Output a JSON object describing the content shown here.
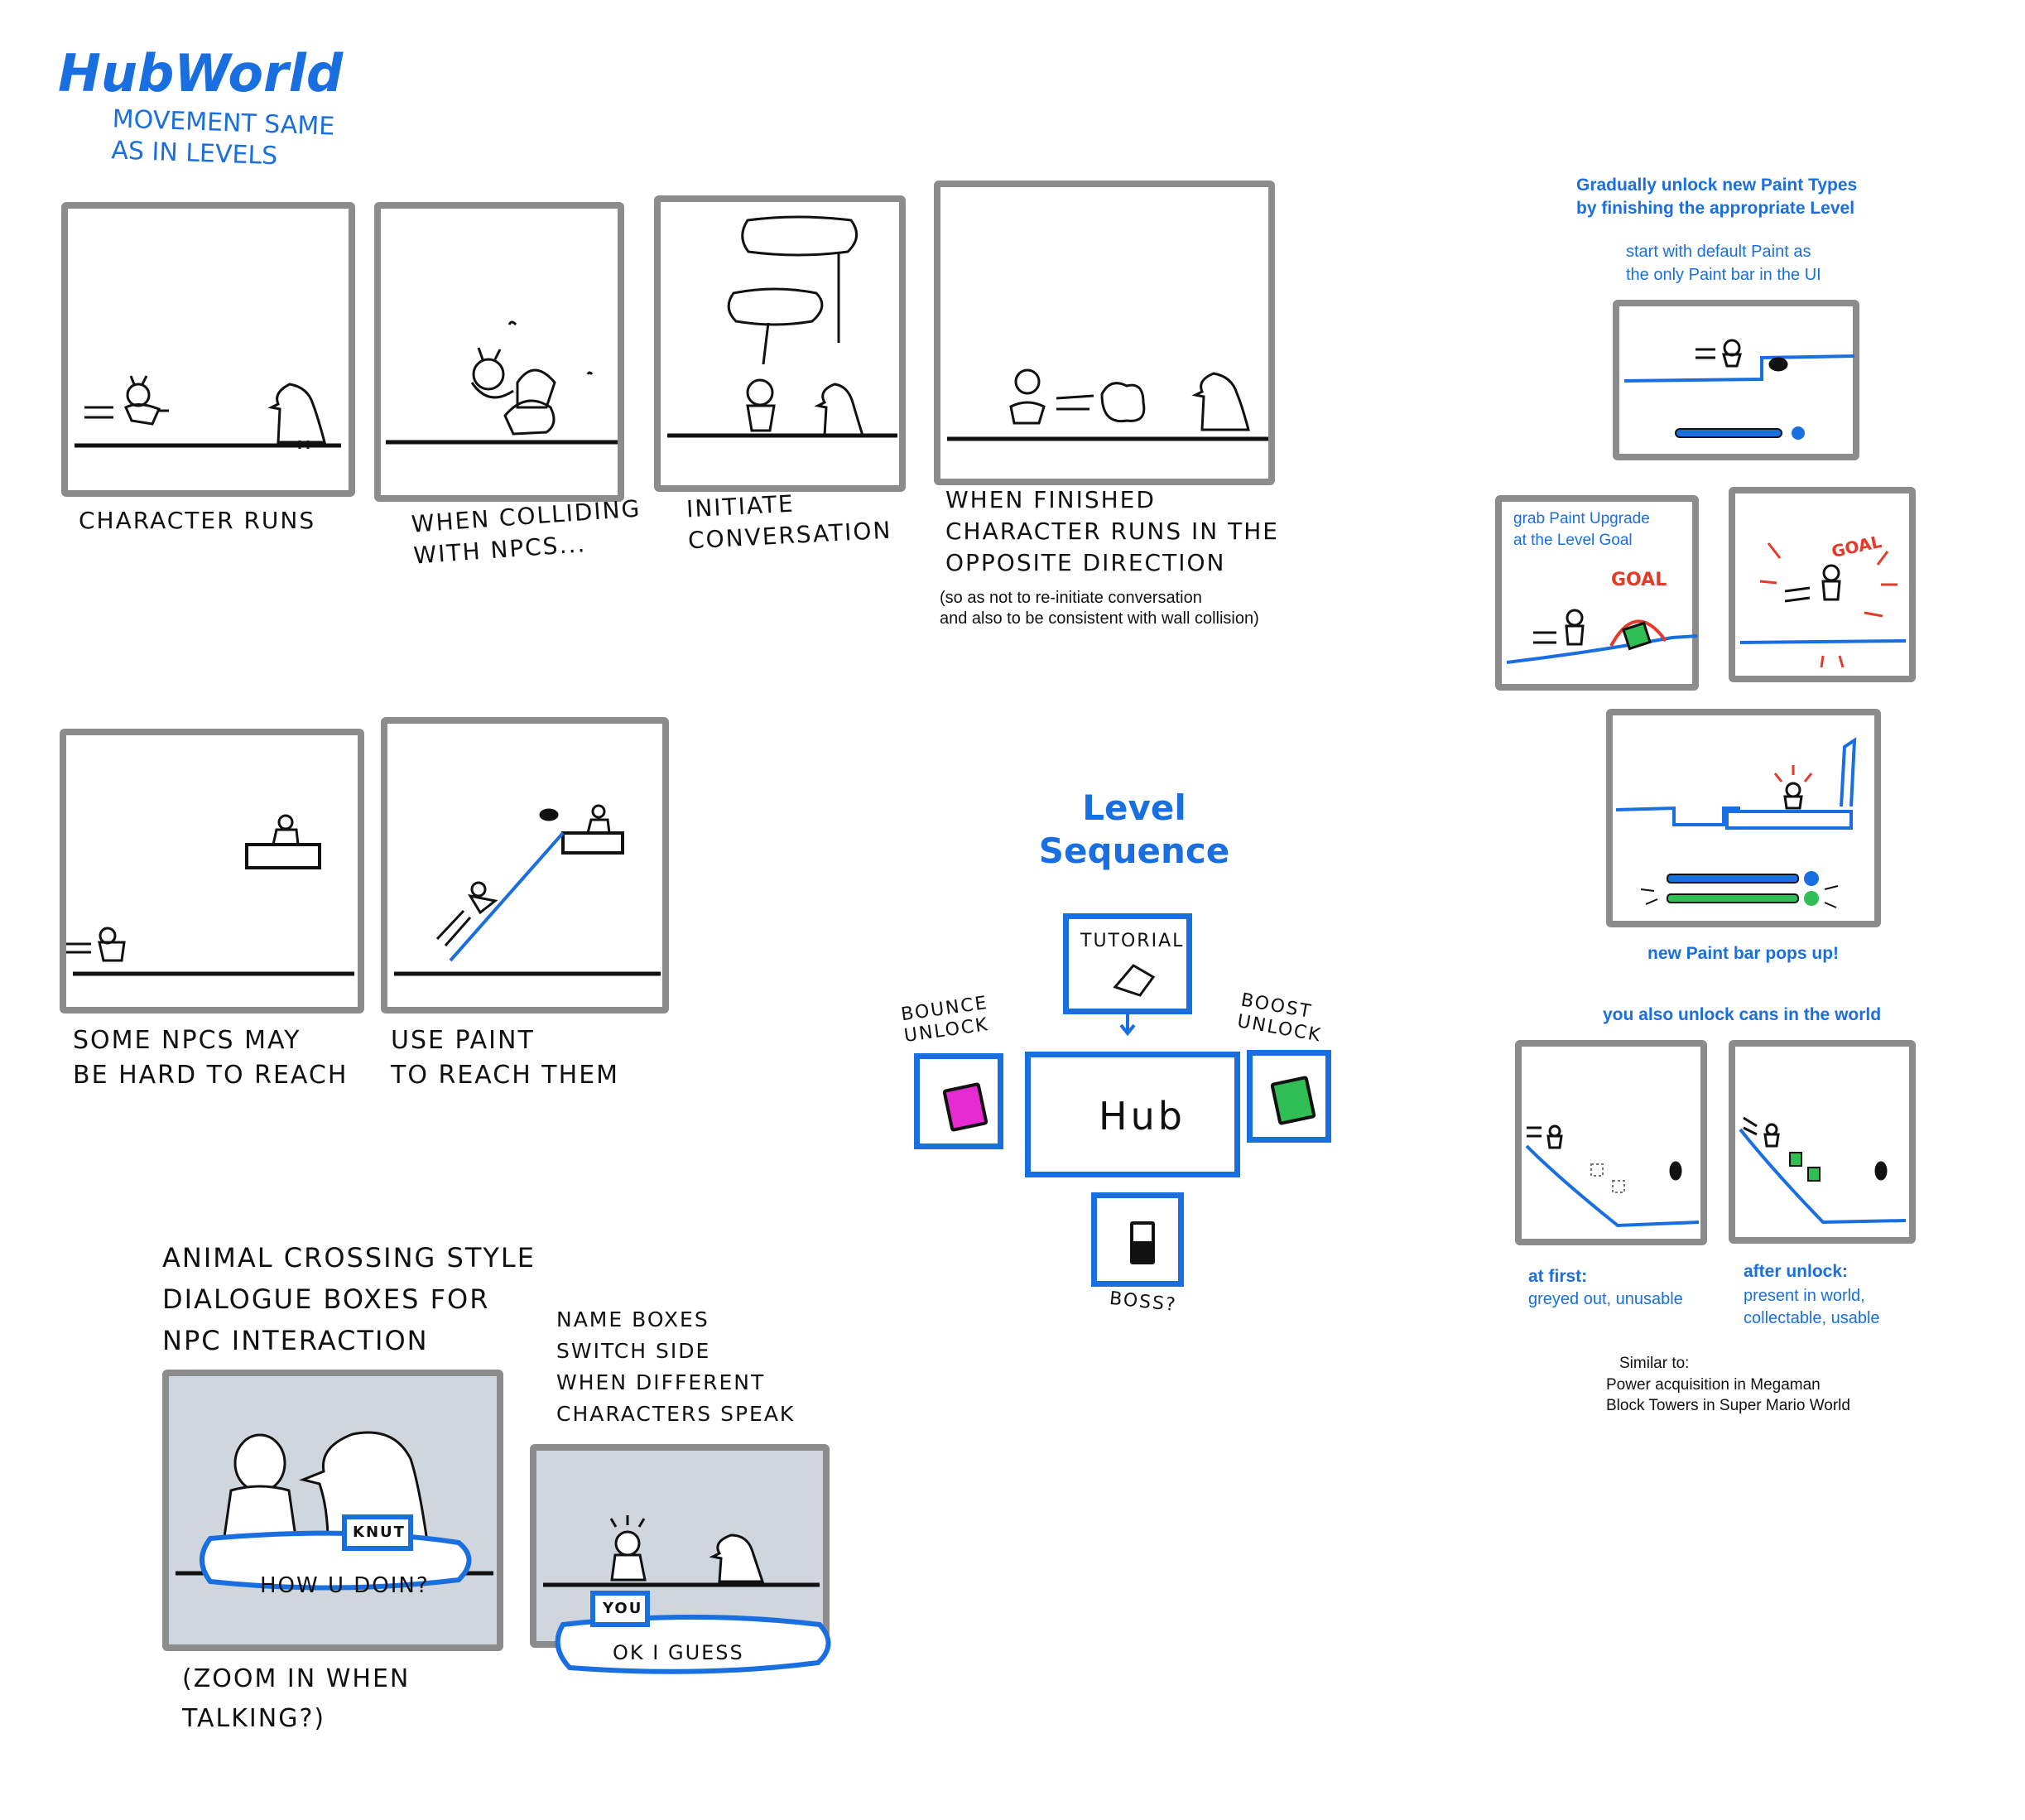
{
  "hubworld": {
    "title": "HubWorld",
    "subtitle": "Movement same\nas in Levels",
    "captions": {
      "p1": "Character runs",
      "p2": "When colliding\nwith NPCs...",
      "p3": "Initiate\nconversation",
      "p4": "When finished\ncharacter runs in the\nopposite direction",
      "p4_note": "(so as not to re-initiate conversation\nand also to be consistent with wall collision)",
      "p5": "Some NPCs may\nbe hard to reach",
      "p6": "Use Paint\nto reach them"
    }
  },
  "dialogue": {
    "title": "Animal Crossing style\ndialogue boxes for\nNPC interaction",
    "note": "(zoom in when\ntalking?)",
    "name_switch": "Name boxes\nswitch side\nwhen different\ncharacters speak",
    "npc_name": "Knut",
    "npc_line": "How u doin?",
    "player_name": "You",
    "player_line": "ok I guess"
  },
  "level_sequence": {
    "title": "Level\nSequence",
    "tutorial": "Tutorial",
    "hub": "Hub",
    "bounce": "Bounce\nunlock",
    "boost": "Boost\nunlock",
    "boss": "Boss?",
    "colors": {
      "bounce": "#e62ad2",
      "boost": "#2fbf55",
      "line": "#1a6fe0"
    }
  },
  "paint_unlock": {
    "heading": "Gradually unlock new Paint Types\nby finishing the appropriate Level",
    "default_note": "start with default Paint as\nthe only Paint bar in the UI",
    "grab_note": "grab Paint Upgrade\nat the Level Goal",
    "goal_label_1": "GOAL",
    "goal_label_2": "GOAL",
    "popup_note": "new Paint bar pops up!",
    "cans_note": "you also unlock cans in the world",
    "at_first_title": "at first:",
    "at_first_desc": "greyed out, unusable",
    "after_title": "after unlock:",
    "after_desc": "present in world,\ncollectable, usable",
    "similar_title": "Similar to:",
    "similar_items": [
      "Power acquisition in Megaman",
      "Block Towers in Super Mario World"
    ]
  }
}
